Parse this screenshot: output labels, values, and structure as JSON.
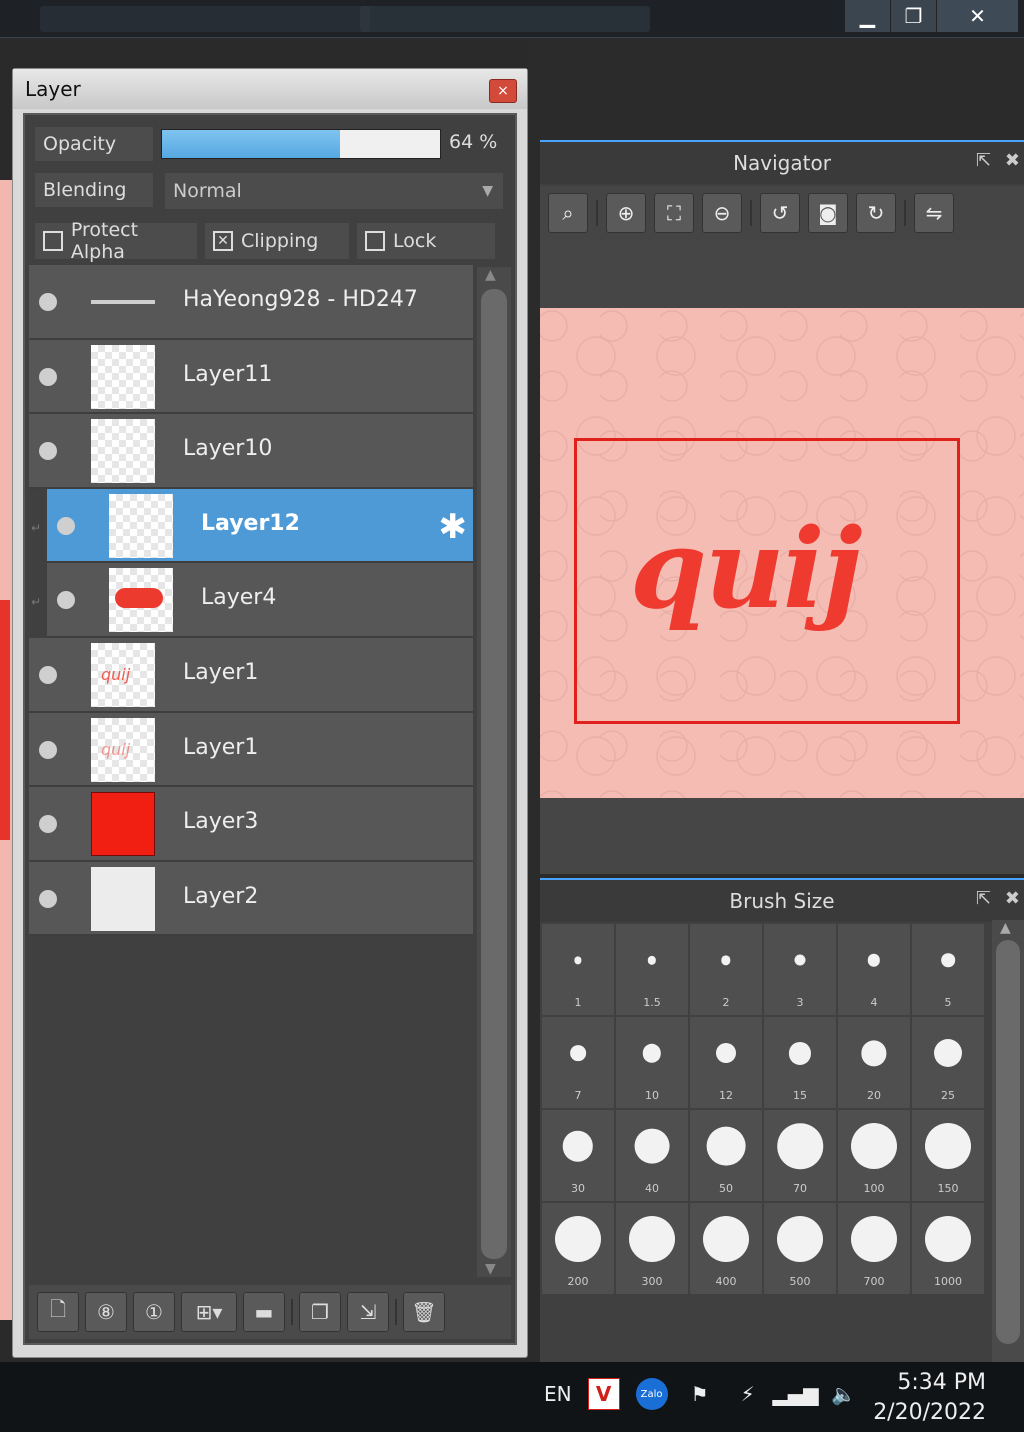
{
  "window_controls": {
    "minimize": "▁",
    "restore": "❐",
    "close": "✕"
  },
  "layer_panel": {
    "title": "Layer",
    "close_icon": "×",
    "opacity_label": "Opacity",
    "opacity_value": "64 %",
    "opacity_fraction": 0.64,
    "blending_label": "Blending",
    "blending_value": "Normal",
    "protect_alpha_label": "Protect Alpha",
    "clipping_label": "Clipping",
    "lock_label": "Lock",
    "layers": [
      {
        "name": "HaYeong928 - HD247",
        "thumb": "line"
      },
      {
        "name": "Layer11",
        "thumb": "transparent"
      },
      {
        "name": "Layer10",
        "thumb": "transparent"
      },
      {
        "name": "Layer12",
        "thumb": "transparent",
        "selected": true,
        "clipped": true
      },
      {
        "name": "Layer4",
        "thumb": "red-blob",
        "clipped": true
      },
      {
        "name": "Layer1",
        "thumb": "text-quij"
      },
      {
        "name": "Layer1",
        "thumb": "text-quij"
      },
      {
        "name": "Layer3",
        "thumb": "solid-red"
      },
      {
        "name": "Layer2",
        "thumb": "noise"
      }
    ],
    "thumb_text": "quij"
  },
  "navigator": {
    "title": "Navigator",
    "artwork_text": "quij"
  },
  "brush_size": {
    "title": "Brush Size",
    "sizes": [
      "1",
      "1.5",
      "2",
      "3",
      "4",
      "5",
      "7",
      "10",
      "12",
      "15",
      "20",
      "25",
      "30",
      "40",
      "50",
      "70",
      "100",
      "150",
      "200",
      "300",
      "400",
      "500",
      "700",
      "1000"
    ]
  },
  "taskbar": {
    "language": "EN",
    "time": "5:34 PM",
    "date": "2/20/2022"
  }
}
